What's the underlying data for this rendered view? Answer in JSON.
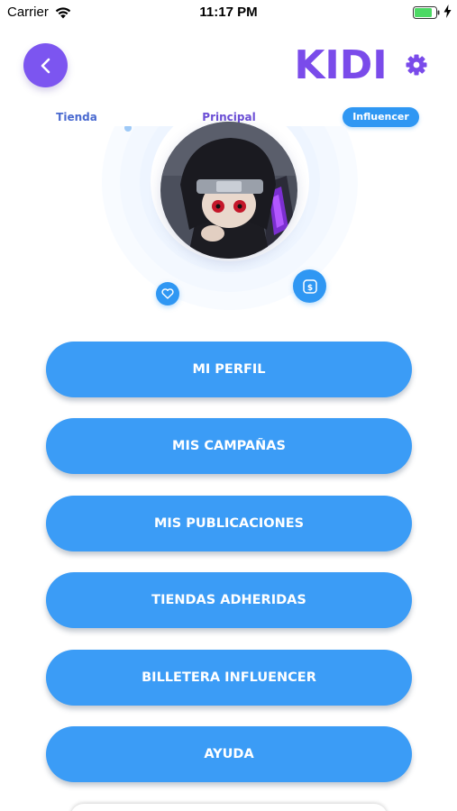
{
  "status_bar": {
    "carrier": "Carrier",
    "time": "11:17 PM",
    "wifi_icon": "wifi-icon",
    "battery_icon": "battery-icon",
    "charging_icon": "charging-bolt-icon"
  },
  "header": {
    "back_icon": "chevron-left-icon",
    "logo_text": "KIDI",
    "settings_icon": "gear-icon"
  },
  "tabs": [
    {
      "label": "Tienda",
      "active": false
    },
    {
      "label": "Principal",
      "active": false
    },
    {
      "label": "Influencer",
      "active": true
    }
  ],
  "profile": {
    "avatar": "profile-avatar-image",
    "like_icon": "heart-icon",
    "money_icon": "dollar-icon"
  },
  "menu": [
    {
      "label": "MI PERFIL"
    },
    {
      "label": "MIS CAMPAÑAS"
    },
    {
      "label": "MIS PUBLICACIONES"
    },
    {
      "label": "TIENDAS ADHERIDAS"
    },
    {
      "label": "BILLETERA INFLUENCER"
    },
    {
      "label": "AYUDA"
    }
  ],
  "colors": {
    "primary_blue": "#3b9cf6",
    "purple": "#7c55f0",
    "logo_purple": "#7a4bea"
  }
}
